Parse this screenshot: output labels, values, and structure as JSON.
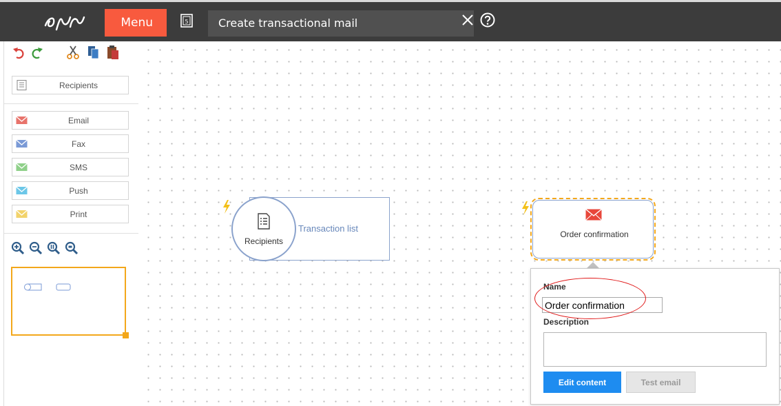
{
  "topbar": {
    "menu_label": "Menu",
    "doc_icon_text": "5",
    "title": "Create transactional mail"
  },
  "palette": {
    "items": [
      {
        "label": "Recipients",
        "icon": "list-icon"
      },
      {
        "label": "Email",
        "icon": "envelope-icon",
        "color": "#e8736b"
      },
      {
        "label": "Fax",
        "icon": "envelope-icon",
        "color": "#7a9ad6"
      },
      {
        "label": "SMS",
        "icon": "envelope-icon",
        "color": "#8fd08a"
      },
      {
        "label": "Push",
        "icon": "envelope-icon",
        "color": "#6cc7e8"
      },
      {
        "label": "Print",
        "icon": "envelope-icon",
        "color": "#f2d36b"
      }
    ]
  },
  "canvas": {
    "recipients_node": {
      "label": "Recipients",
      "list_label": "Transaction list"
    },
    "order_node": {
      "label": "Order confirmation"
    }
  },
  "popup": {
    "name_label": "Name",
    "name_value": "Order confirmation",
    "description_label": "Description",
    "description_value": "",
    "edit_button": "Edit content",
    "test_button": "Test email"
  },
  "colors": {
    "menu": "#f85a3e",
    "accent": "#f3a71a",
    "primary_button": "#1e8cf0",
    "node_border": "#8aa2cc",
    "highlight": "#e01818"
  }
}
